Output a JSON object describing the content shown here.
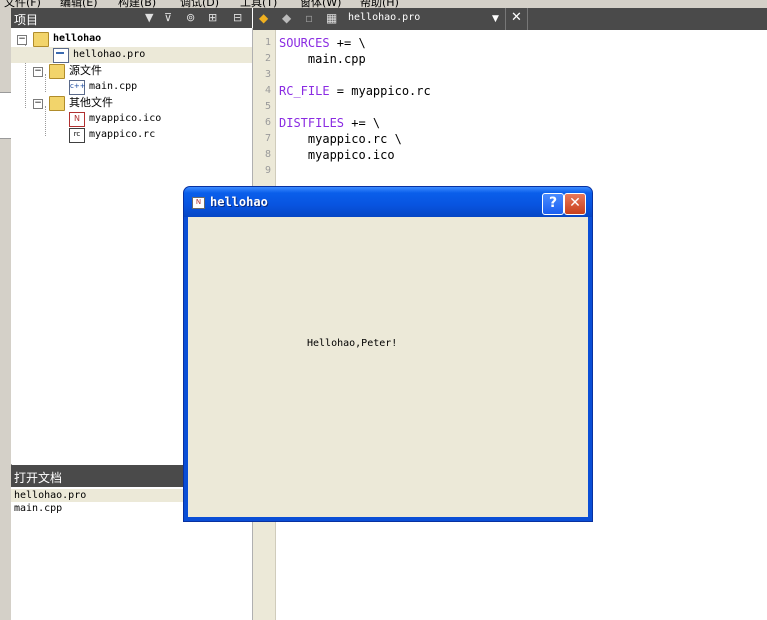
{
  "menu": {
    "items": [
      "文件(F)",
      "编辑(E)",
      "构建(B)",
      "调试(D)",
      "工具(T)",
      "窗体(W)",
      "帮助(H)"
    ]
  },
  "project_panel": {
    "title": "项目",
    "tree": {
      "root": "hellohao",
      "pro_file": "hellohao.pro",
      "sources_folder": "源文件",
      "main_cpp": "main.cpp",
      "other_folder": "其他文件",
      "ico_file": "myappico.ico",
      "rc_file": "myappico.rc"
    }
  },
  "open_docs": {
    "title": "打开文档",
    "items": [
      "hellohao.pro",
      "main.cpp"
    ]
  },
  "editor": {
    "file_name": "hellohao.pro",
    "line_numbers": [
      "1",
      "2",
      "3",
      "4",
      "5",
      "6",
      "7",
      "8",
      "9"
    ],
    "lines": [
      {
        "kw": "SOURCES",
        "rest": " += \\"
      },
      {
        "kw": "",
        "rest": "    main.cpp"
      },
      {
        "kw": "",
        "rest": ""
      },
      {
        "kw": "RC_FILE",
        "rest": " = myappico.rc"
      },
      {
        "kw": "",
        "rest": ""
      },
      {
        "kw": "DISTFILES",
        "rest": " += \\"
      },
      {
        "kw": "",
        "rest": "    myappico.rc \\"
      },
      {
        "kw": "",
        "rest": "    myappico.ico"
      },
      {
        "kw": "",
        "rest": ""
      }
    ]
  },
  "dialog": {
    "title": "hellohao",
    "help_label": "?",
    "close_label": "✕",
    "message": "Hellohao,Peter!"
  },
  "colors": {
    "title_blue": "#0a5eea",
    "keyword": "#8a2be2",
    "panel_header": "#4a4a4a"
  }
}
